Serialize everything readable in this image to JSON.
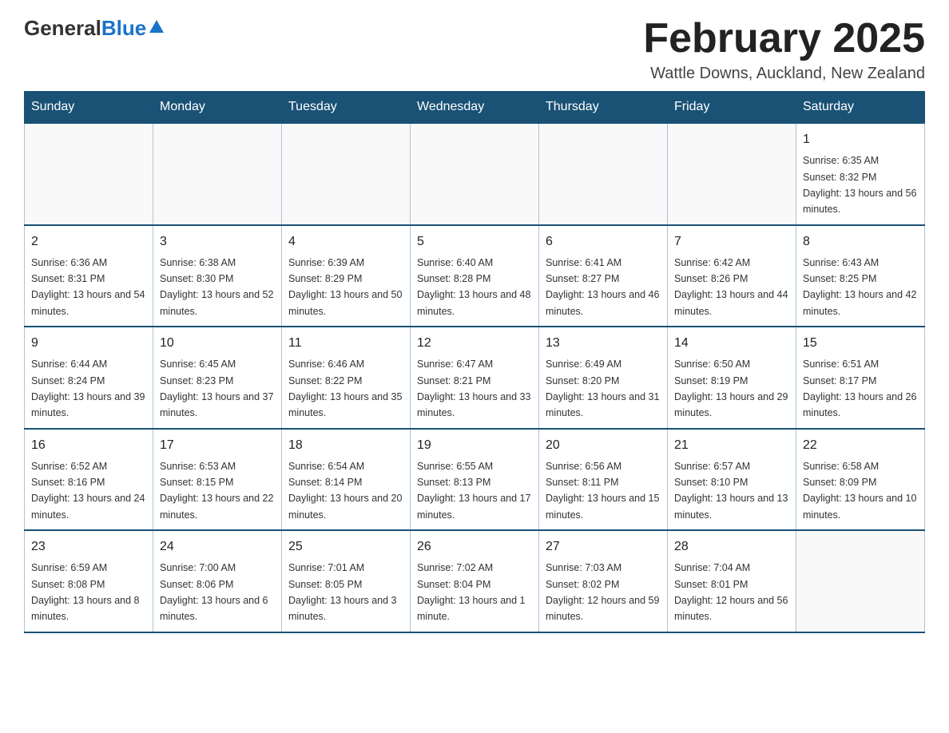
{
  "header": {
    "logo_general": "General",
    "logo_blue": "Blue",
    "month_title": "February 2025",
    "location": "Wattle Downs, Auckland, New Zealand"
  },
  "days_of_week": [
    "Sunday",
    "Monday",
    "Tuesday",
    "Wednesday",
    "Thursday",
    "Friday",
    "Saturday"
  ],
  "weeks": [
    [
      {
        "day": "",
        "info": ""
      },
      {
        "day": "",
        "info": ""
      },
      {
        "day": "",
        "info": ""
      },
      {
        "day": "",
        "info": ""
      },
      {
        "day": "",
        "info": ""
      },
      {
        "day": "",
        "info": ""
      },
      {
        "day": "1",
        "info": "Sunrise: 6:35 AM\nSunset: 8:32 PM\nDaylight: 13 hours and 56 minutes."
      }
    ],
    [
      {
        "day": "2",
        "info": "Sunrise: 6:36 AM\nSunset: 8:31 PM\nDaylight: 13 hours and 54 minutes."
      },
      {
        "day": "3",
        "info": "Sunrise: 6:38 AM\nSunset: 8:30 PM\nDaylight: 13 hours and 52 minutes."
      },
      {
        "day": "4",
        "info": "Sunrise: 6:39 AM\nSunset: 8:29 PM\nDaylight: 13 hours and 50 minutes."
      },
      {
        "day": "5",
        "info": "Sunrise: 6:40 AM\nSunset: 8:28 PM\nDaylight: 13 hours and 48 minutes."
      },
      {
        "day": "6",
        "info": "Sunrise: 6:41 AM\nSunset: 8:27 PM\nDaylight: 13 hours and 46 minutes."
      },
      {
        "day": "7",
        "info": "Sunrise: 6:42 AM\nSunset: 8:26 PM\nDaylight: 13 hours and 44 minutes."
      },
      {
        "day": "8",
        "info": "Sunrise: 6:43 AM\nSunset: 8:25 PM\nDaylight: 13 hours and 42 minutes."
      }
    ],
    [
      {
        "day": "9",
        "info": "Sunrise: 6:44 AM\nSunset: 8:24 PM\nDaylight: 13 hours and 39 minutes."
      },
      {
        "day": "10",
        "info": "Sunrise: 6:45 AM\nSunset: 8:23 PM\nDaylight: 13 hours and 37 minutes."
      },
      {
        "day": "11",
        "info": "Sunrise: 6:46 AM\nSunset: 8:22 PM\nDaylight: 13 hours and 35 minutes."
      },
      {
        "day": "12",
        "info": "Sunrise: 6:47 AM\nSunset: 8:21 PM\nDaylight: 13 hours and 33 minutes."
      },
      {
        "day": "13",
        "info": "Sunrise: 6:49 AM\nSunset: 8:20 PM\nDaylight: 13 hours and 31 minutes."
      },
      {
        "day": "14",
        "info": "Sunrise: 6:50 AM\nSunset: 8:19 PM\nDaylight: 13 hours and 29 minutes."
      },
      {
        "day": "15",
        "info": "Sunrise: 6:51 AM\nSunset: 8:17 PM\nDaylight: 13 hours and 26 minutes."
      }
    ],
    [
      {
        "day": "16",
        "info": "Sunrise: 6:52 AM\nSunset: 8:16 PM\nDaylight: 13 hours and 24 minutes."
      },
      {
        "day": "17",
        "info": "Sunrise: 6:53 AM\nSunset: 8:15 PM\nDaylight: 13 hours and 22 minutes."
      },
      {
        "day": "18",
        "info": "Sunrise: 6:54 AM\nSunset: 8:14 PM\nDaylight: 13 hours and 20 minutes."
      },
      {
        "day": "19",
        "info": "Sunrise: 6:55 AM\nSunset: 8:13 PM\nDaylight: 13 hours and 17 minutes."
      },
      {
        "day": "20",
        "info": "Sunrise: 6:56 AM\nSunset: 8:11 PM\nDaylight: 13 hours and 15 minutes."
      },
      {
        "day": "21",
        "info": "Sunrise: 6:57 AM\nSunset: 8:10 PM\nDaylight: 13 hours and 13 minutes."
      },
      {
        "day": "22",
        "info": "Sunrise: 6:58 AM\nSunset: 8:09 PM\nDaylight: 13 hours and 10 minutes."
      }
    ],
    [
      {
        "day": "23",
        "info": "Sunrise: 6:59 AM\nSunset: 8:08 PM\nDaylight: 13 hours and 8 minutes."
      },
      {
        "day": "24",
        "info": "Sunrise: 7:00 AM\nSunset: 8:06 PM\nDaylight: 13 hours and 6 minutes."
      },
      {
        "day": "25",
        "info": "Sunrise: 7:01 AM\nSunset: 8:05 PM\nDaylight: 13 hours and 3 minutes."
      },
      {
        "day": "26",
        "info": "Sunrise: 7:02 AM\nSunset: 8:04 PM\nDaylight: 13 hours and 1 minute."
      },
      {
        "day": "27",
        "info": "Sunrise: 7:03 AM\nSunset: 8:02 PM\nDaylight: 12 hours and 59 minutes."
      },
      {
        "day": "28",
        "info": "Sunrise: 7:04 AM\nSunset: 8:01 PM\nDaylight: 12 hours and 56 minutes."
      },
      {
        "day": "",
        "info": ""
      }
    ]
  ]
}
